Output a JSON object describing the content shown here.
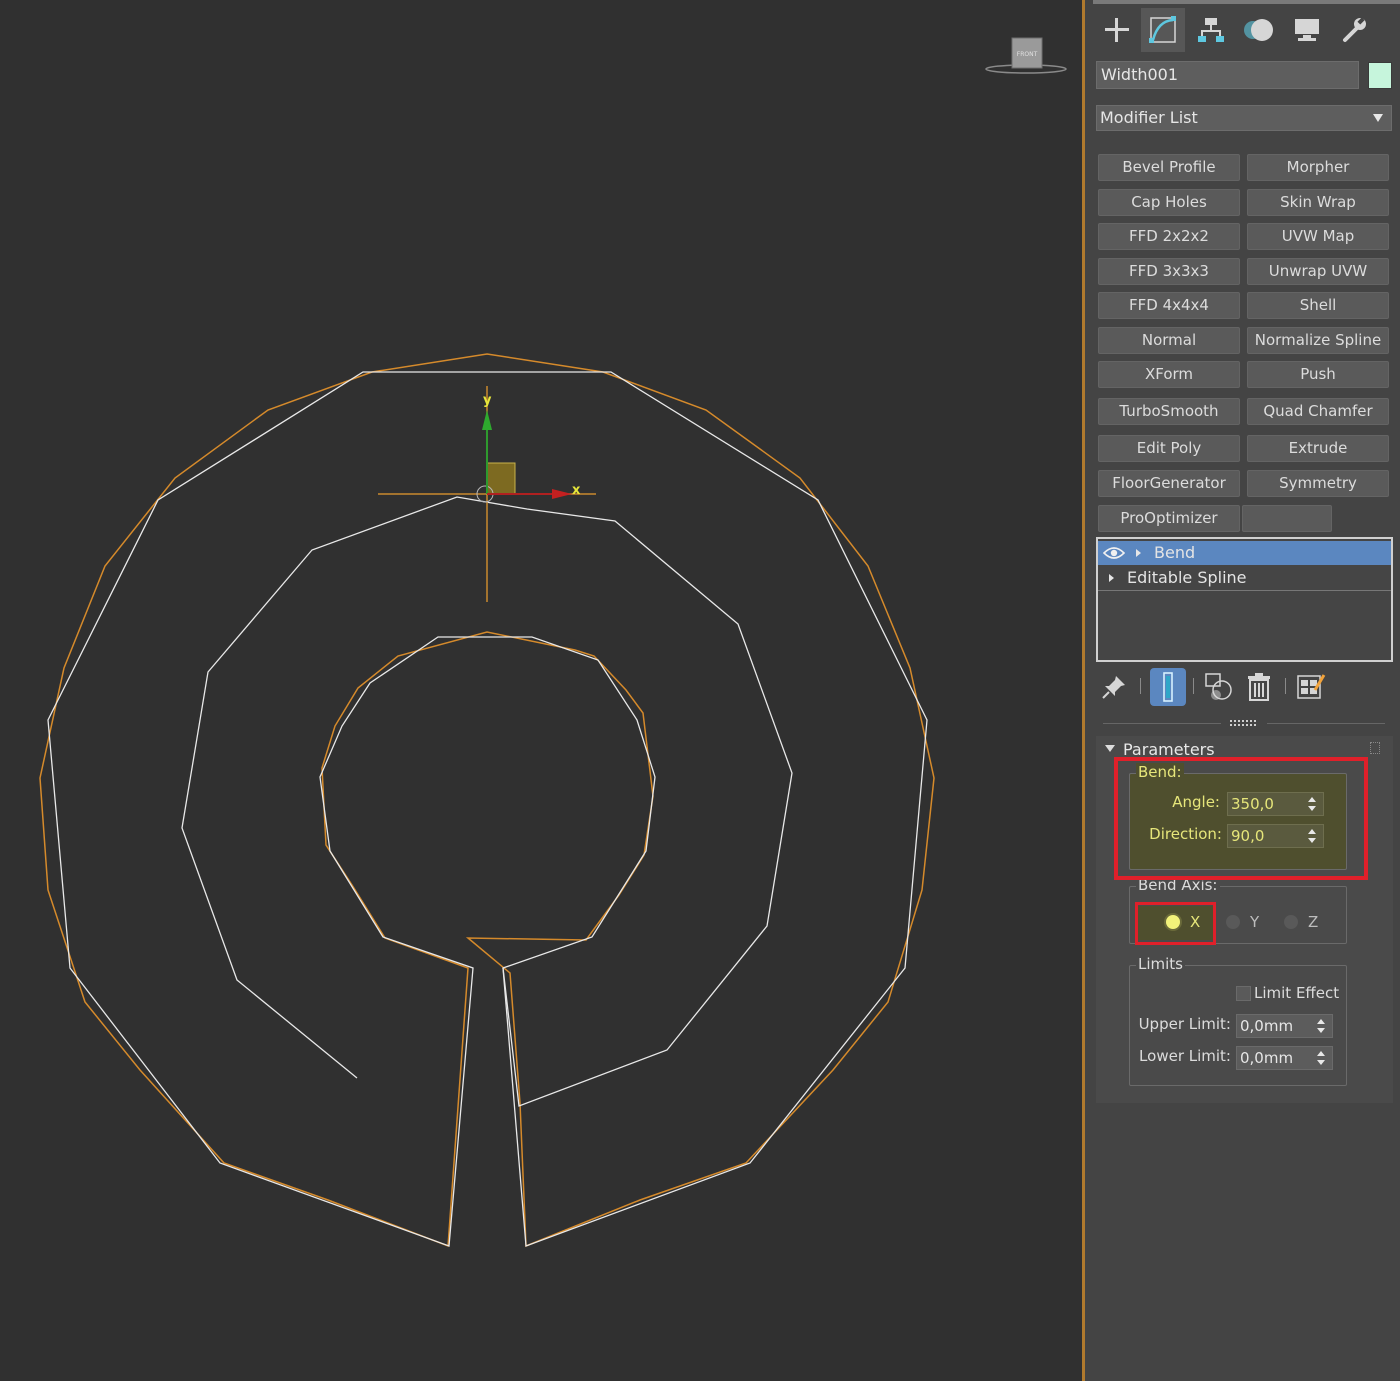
{
  "viewport": {
    "viewcube_label": "FRONT",
    "gizmo": {
      "y_label": "y",
      "x_label": "x"
    }
  },
  "panel": {
    "tabs": [
      {
        "name": "create-tab",
        "icon": "plus-icon"
      },
      {
        "name": "modify-tab",
        "icon": "modify-curve-icon",
        "active": true
      },
      {
        "name": "hierarchy-tab",
        "icon": "hierarchy-icon"
      },
      {
        "name": "motion-tab",
        "icon": "motion-icon"
      },
      {
        "name": "display-tab",
        "icon": "monitor-icon"
      },
      {
        "name": "utilities-tab",
        "icon": "wrench-icon"
      }
    ],
    "object_name": "Width001",
    "object_color": "#c6f5dc",
    "modifier_list_label": "Modifier List",
    "modifier_buttons": [
      "Bevel Profile",
      "Morpher",
      "Cap Holes",
      "Skin Wrap",
      "FFD 2x2x2",
      "UVW Map",
      "FFD 3x3x3",
      "Unwrap UVW",
      "FFD 4x4x4",
      "Shell",
      "Normal",
      "Normalize Spline",
      "XForm",
      "Push",
      "TurboSmooth",
      "Quad Chamfer",
      "Edit Poly",
      "Extrude",
      "FloorGenerator",
      "Symmetry",
      "ProOptimizer",
      ""
    ],
    "stack": [
      {
        "label": "Bend",
        "selected": true
      },
      {
        "label": "Editable Spline",
        "selected": false
      }
    ],
    "parameters": {
      "title": "Parameters",
      "bend_group": "Bend:",
      "angle_label": "Angle:",
      "angle_value": "350,0",
      "direction_label": "Direction:",
      "direction_value": "90,0",
      "bend_axis_group": "Bend Axis:",
      "axis_x": "X",
      "axis_y": "Y",
      "axis_z": "Z",
      "selected_axis": "X",
      "limits_group": "Limits",
      "limit_effect_label": "Limit Effect",
      "upper_limit_label": "Upper Limit:",
      "upper_limit_value": "0,0mm",
      "lower_limit_label": "Lower Limit:",
      "lower_limit_value": "0,0mm"
    }
  }
}
